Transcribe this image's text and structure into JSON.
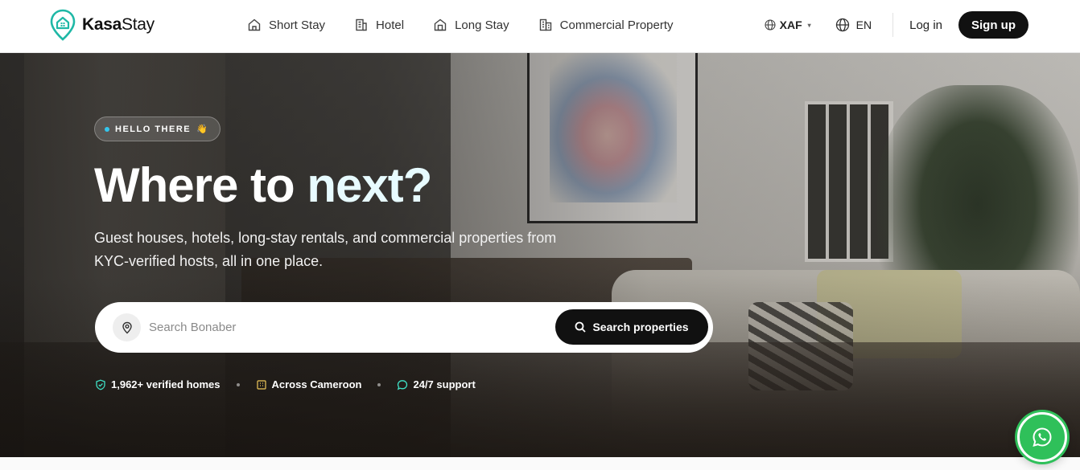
{
  "brand": {
    "name_bold": "Kasa",
    "name_rest": "Stay"
  },
  "nav": {
    "links": [
      {
        "label": "Short Stay",
        "icon": "house-icon"
      },
      {
        "label": "Hotel",
        "icon": "building-icon"
      },
      {
        "label": "Long Stay",
        "icon": "home-door-icon"
      },
      {
        "label": "Commercial Property",
        "icon": "office-buildings-icon"
      }
    ],
    "currency": "XAF",
    "language": "EN",
    "login_label": "Log in",
    "signup_label": "Sign up"
  },
  "hero": {
    "badge": "HELLO THERE",
    "badge_emoji": "👋",
    "title_part1": "Where to ",
    "title_part2": "next?",
    "subtitle": "Guest houses, hotels, long-stay rentals, and commercial properties from KYC-verified hosts, all in one place.",
    "search": {
      "placeholder": "Search Bonaber",
      "value": "",
      "button_label": "Search properties"
    },
    "stats": [
      {
        "label": "1,962+ verified homes",
        "icon": "shield-check-icon"
      },
      {
        "label": "Across Cameroon",
        "icon": "building-grid-icon"
      },
      {
        "label": "24/7 support",
        "icon": "chat-bubble-icon"
      }
    ]
  },
  "colors": {
    "accent": "#1fb8a6",
    "stat_icon": "#3fe0c5",
    "whatsapp": "#2fc05a",
    "dark": "#111111"
  }
}
